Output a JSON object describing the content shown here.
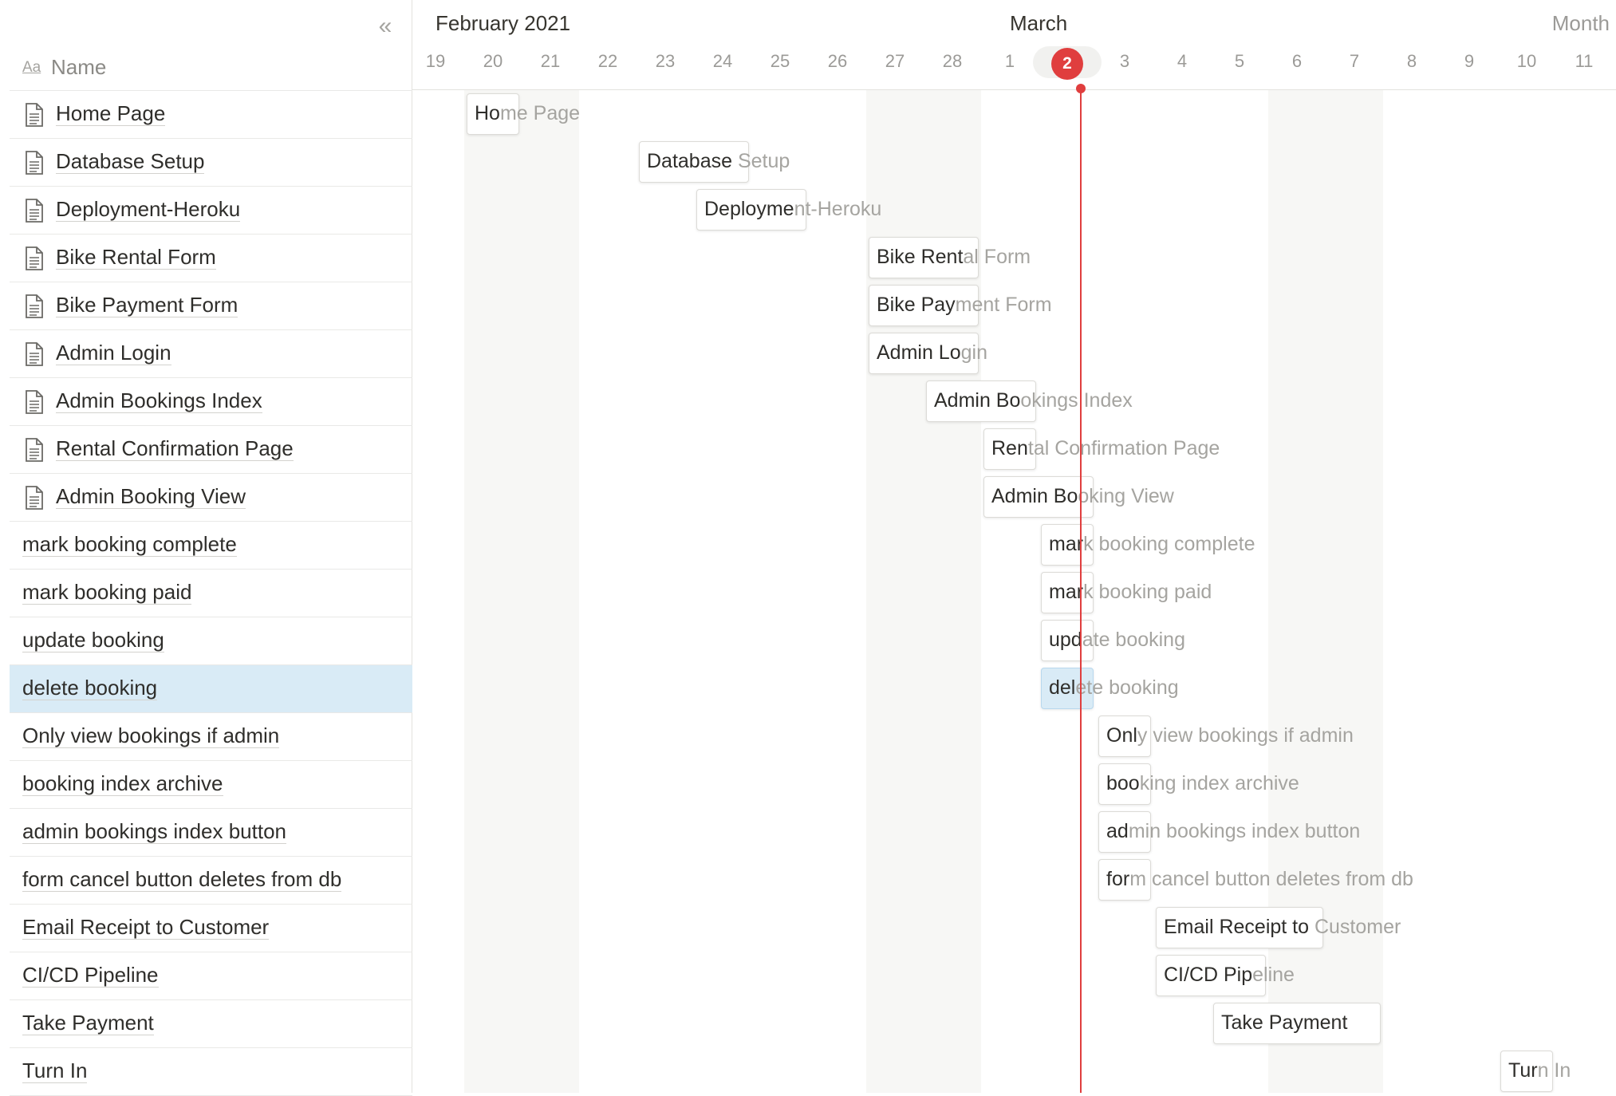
{
  "sidebar": {
    "collapse_glyph": "«",
    "collapse_icon": "double-chevron-left-icon",
    "name_header": {
      "icon_text": "Aa",
      "label": "Name"
    }
  },
  "timeline": {
    "months": [
      {
        "label": "February 2021",
        "start_index": 0
      },
      {
        "label": "March",
        "start_index": 10
      }
    ],
    "view_mode": "Month",
    "days": [
      "19",
      "20",
      "21",
      "22",
      "23",
      "24",
      "25",
      "26",
      "27",
      "28",
      "1",
      "2",
      "3",
      "4",
      "5",
      "6",
      "7",
      "8",
      "9",
      "10",
      "11"
    ],
    "today_index": 11,
    "weekend_indices": [
      1,
      2,
      8,
      9,
      15,
      16
    ]
  },
  "accent": {
    "today": "#e03e3e",
    "selected": "#d9ebf6"
  },
  "tasks": [
    {
      "name": "Home Page",
      "page": true,
      "start": 1,
      "end": 1,
      "selected": false
    },
    {
      "name": "Database Setup",
      "page": true,
      "start": 4,
      "end": 5,
      "selected": false
    },
    {
      "name": "Deployment-Heroku",
      "page": true,
      "start": 5,
      "end": 6,
      "selected": false
    },
    {
      "name": "Bike Rental Form",
      "page": true,
      "start": 8,
      "end": 9,
      "selected": false
    },
    {
      "name": "Bike Payment Form",
      "page": true,
      "start": 8,
      "end": 9,
      "selected": false
    },
    {
      "name": "Admin Login",
      "page": true,
      "start": 8,
      "end": 9,
      "selected": false
    },
    {
      "name": "Admin Bookings Index",
      "page": true,
      "start": 9,
      "end": 10,
      "selected": false
    },
    {
      "name": "Rental Confirmation Page",
      "page": true,
      "start": 10,
      "end": 10,
      "selected": false
    },
    {
      "name": "Admin Booking View",
      "page": true,
      "start": 10,
      "end": 11,
      "selected": false
    },
    {
      "name": "mark booking complete",
      "page": false,
      "start": 11,
      "end": 11,
      "selected": false
    },
    {
      "name": "mark booking paid",
      "page": false,
      "start": 11,
      "end": 11,
      "selected": false
    },
    {
      "name": "update booking",
      "page": false,
      "start": 11,
      "end": 11,
      "selected": false
    },
    {
      "name": "delete booking",
      "page": false,
      "start": 11,
      "end": 11,
      "selected": true
    },
    {
      "name": "Only view bookings if admin",
      "page": false,
      "start": 12,
      "end": 12,
      "selected": false
    },
    {
      "name": "booking index archive",
      "page": false,
      "start": 12,
      "end": 12,
      "selected": false
    },
    {
      "name": "admin bookings index button",
      "page": false,
      "start": 12,
      "end": 12,
      "selected": false
    },
    {
      "name": "form cancel button deletes from db",
      "page": false,
      "start": 12,
      "end": 12,
      "selected": false
    },
    {
      "name": "Email Receipt to Customer",
      "page": false,
      "start": 13,
      "end": 15,
      "selected": false
    },
    {
      "name": "CI/CD Pipeline",
      "page": false,
      "start": 13,
      "end": 14,
      "selected": false
    },
    {
      "name": "Take Payment",
      "page": false,
      "start": 14,
      "end": 16,
      "selected": false
    },
    {
      "name": "Turn In",
      "page": false,
      "start": 19,
      "end": 19,
      "selected": false
    }
  ]
}
